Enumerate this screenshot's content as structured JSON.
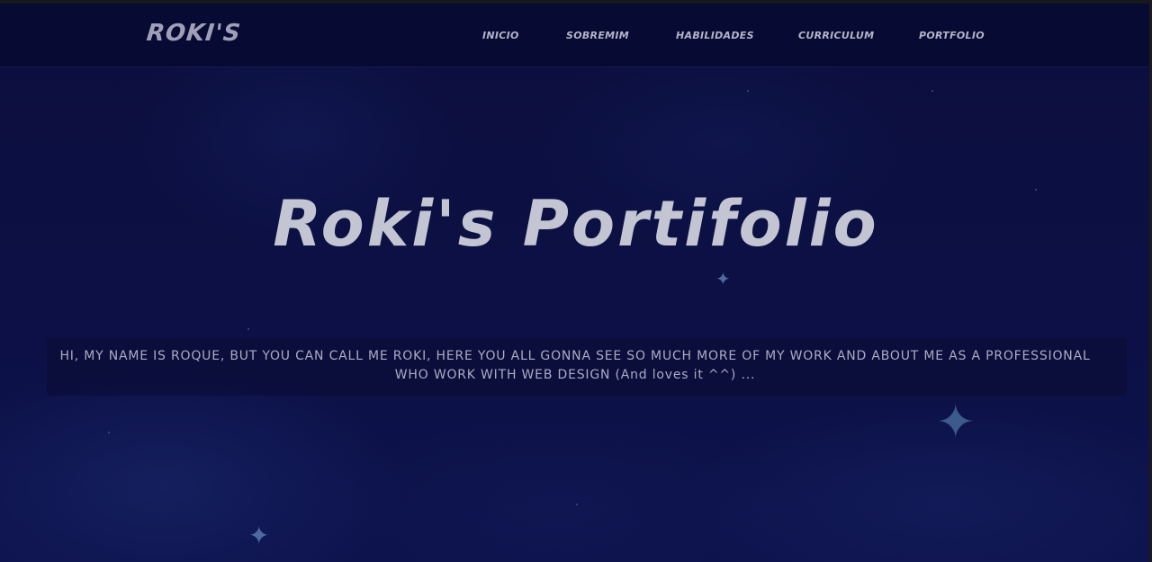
{
  "header": {
    "logo": "ROKI'S",
    "nav": [
      {
        "label": "INICIO"
      },
      {
        "label": "SOBREMIM"
      },
      {
        "label": "HABILIDADES"
      },
      {
        "label": "CURRICULUM"
      },
      {
        "label": "PORTFOLIO"
      }
    ]
  },
  "hero": {
    "title": "Roki's Portifolio",
    "intro": "HI, MY NAME IS ROQUE, BUT YOU CAN CALL ME ROKI, HERE YOU ALL GONNA SEE SO MUCH MORE OF MY WORK AND ABOUT ME AS A PROFESSIONAL WHO WORK WITH WEB DESIGN (And loves it ^^) ..."
  },
  "decor": {
    "star_icon": "sparkle-star-icon"
  },
  "colors": {
    "background": "#0b0e3d",
    "navbar": "#070a33",
    "text": "#c4c5d3"
  }
}
